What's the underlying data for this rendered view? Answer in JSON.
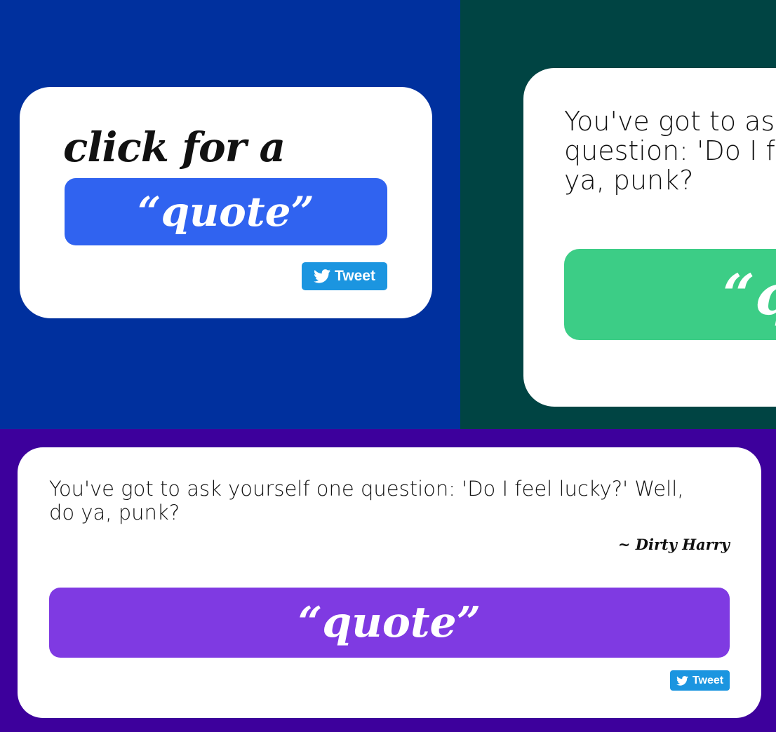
{
  "colors": {
    "panel_a_bg": "#00309e",
    "panel_b_bg": "#004443",
    "panel_c_bg": "#3d009c",
    "button_a": "#3063f0",
    "button_b": "#3ccd86",
    "button_c": "#7f3ae2",
    "tweet": "#1b95e0"
  },
  "panel_a": {
    "heading": "click for a",
    "quote_button": "“quote”",
    "tweet_label": "Tweet",
    "tweet_icon": "twitter-bird-icon"
  },
  "panel_b": {
    "quote_text": "You've got to ask yourself one question: 'Do I feel lucky?' Well, do ya, punk?",
    "quote_button": "“quote”"
  },
  "panel_c": {
    "quote_text": "You've got to ask yourself one question: 'Do I feel lucky?' Well, do ya, punk?",
    "author": "~ Dirty Harry",
    "quote_button": "“quote”",
    "tweet_label": "Tweet",
    "tweet_icon": "twitter-bird-icon"
  }
}
